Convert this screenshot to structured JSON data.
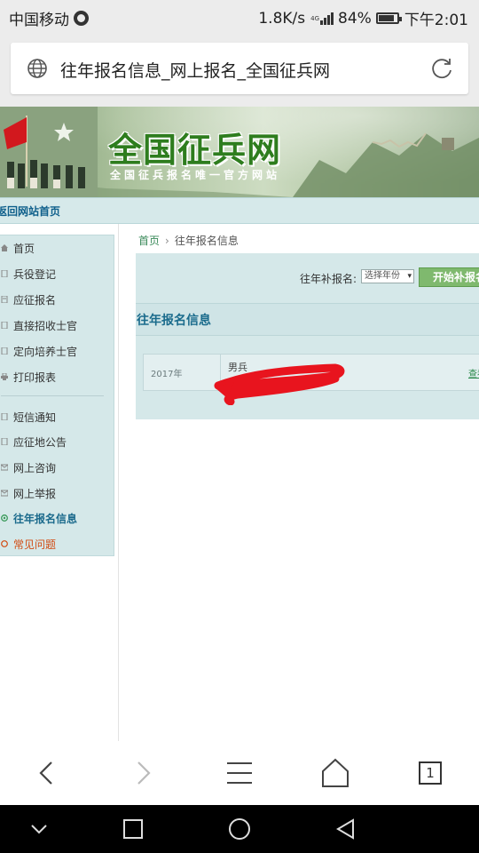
{
  "status_bar": {
    "carrier": "中国移动",
    "speed": "1.8K/s",
    "network": "4G",
    "battery": "84%",
    "battery_level": 0.84,
    "time": "下午2:01"
  },
  "browser": {
    "page_title": "往年报名信息_网上报名_全国征兵网",
    "tab_count": "1"
  },
  "site": {
    "title": "全国征兵网",
    "subtitle": "全国征兵报名唯一官方网站",
    "return_link": "返回网站首页"
  },
  "sidebar": {
    "items": [
      {
        "label": "首页",
        "icon": "home-icon"
      },
      {
        "label": "兵役登记",
        "icon": "register-icon"
      },
      {
        "label": "应征报名",
        "icon": "enlist-icon"
      },
      {
        "label": "直接招收士官",
        "icon": "recruit-icon"
      },
      {
        "label": "定向培养士官",
        "icon": "training-icon"
      },
      {
        "label": "打印报表",
        "icon": "print-icon"
      },
      {
        "label": "短信通知",
        "icon": "sms-icon"
      },
      {
        "label": "应征地公告",
        "icon": "notice-icon"
      },
      {
        "label": "网上咨询",
        "icon": "consult-icon"
      },
      {
        "label": "网上举报",
        "icon": "report-icon"
      },
      {
        "label": "往年报名信息",
        "icon": "history-icon"
      },
      {
        "label": "常见问题",
        "icon": "faq-icon"
      }
    ]
  },
  "main": {
    "breadcrumb": {
      "home": "首页",
      "current": "往年报名信息"
    },
    "supplement_label": "往年补报名:",
    "year_select": "选择年份",
    "start_button": "开始补报名",
    "section_title": "往年报名信息",
    "record": {
      "year": "2017年",
      "type": "男兵",
      "link": "查看"
    }
  },
  "colors": {
    "accent_teal": "#1a6b8c",
    "panel_bg": "#d5e8e9",
    "button_green": "#7fb96e",
    "title_green": "#2e7d1e",
    "faq_orange": "#d24b12",
    "scribble_red": "#e8141e"
  }
}
